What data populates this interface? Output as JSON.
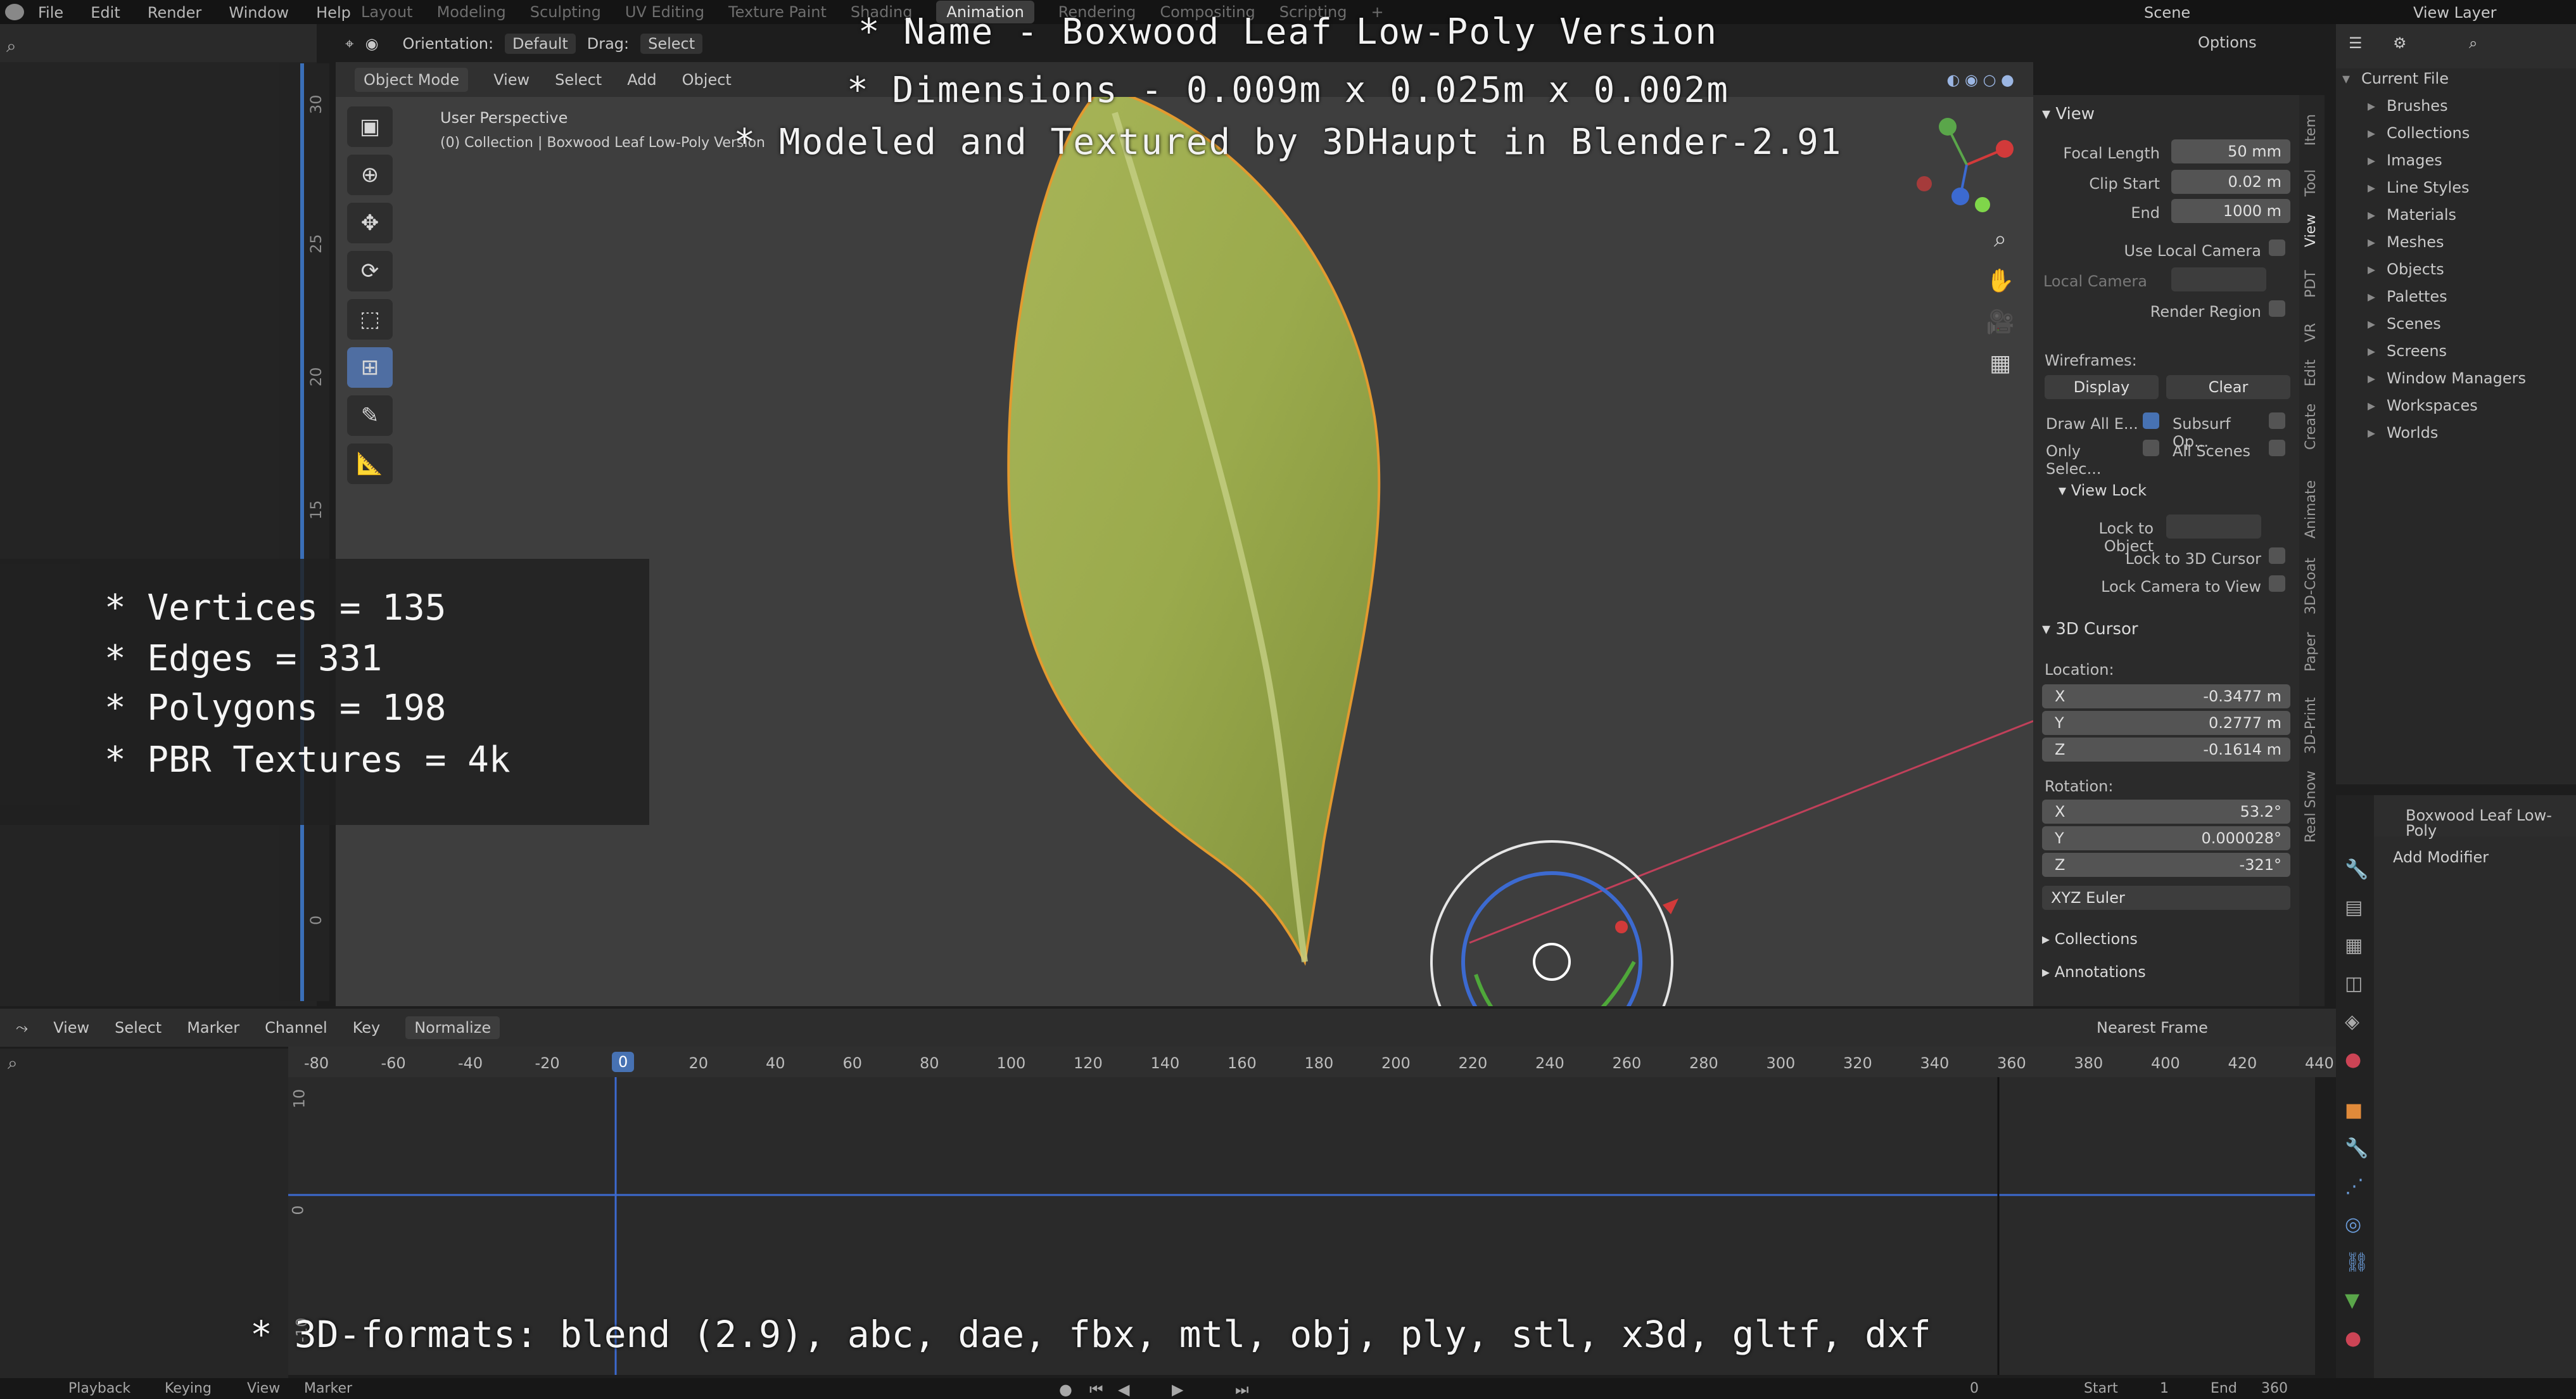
{
  "overlay": {
    "line1": "* Name - Boxwood Leaf Low-Poly Version",
    "line2": "* Dimensions -  0.009m x 0.025m x 0.002m",
    "line3": "* Modeled and Textured by 3DHaupt in Blender-2.91",
    "stats": [
      "* Vertices = 135",
      "* Edges = 331",
      "* Polygons = 198",
      "* PBR Textures = 4k"
    ],
    "formats": "* 3D-formats: blend (2.9), abc, dae, fbx, mtl, obj, ply, stl, x3d, gltf, dxf"
  },
  "topbar": {
    "menu": [
      "File",
      "Edit",
      "Render",
      "Window",
      "Help"
    ],
    "workspaces": [
      "Layout",
      "Modeling",
      "Sculpting",
      "UV Editing",
      "Texture Paint",
      "Shading",
      "Animation",
      "Rendering",
      "Compositing",
      "Scripting"
    ],
    "active_workspace": "Animation",
    "scene_label": "Scene",
    "view_layer_label": "View Layer"
  },
  "viewport": {
    "orientation_label": "Orientation:",
    "orientation_value": "Default",
    "drag_label": "Drag:",
    "drag_value": "Select",
    "options_label": "Options",
    "mode": "Object Mode",
    "menus": [
      "View",
      "Select",
      "Add",
      "Object"
    ],
    "perspective": "User Perspective",
    "collection_info": "(0) Collection | Boxwood Leaf Low-Poly Version"
  },
  "npanel": {
    "view_header": "View",
    "focal_length_label": "Focal Length",
    "focal_length": "50 mm",
    "clip_start_label": "Clip Start",
    "clip_start": "0.02 m",
    "end_label": "End",
    "end": "1000 m",
    "use_local_camera": "Use Local Camera",
    "local_camera": "Local Camera",
    "render_region": "Render Region",
    "wireframes": "Wireframes:",
    "display": "Display",
    "clear": "Clear",
    "draw_all": "Draw All E...",
    "subsurf": "Subsurf Op...",
    "only_selec": "Only Selec...",
    "all_scenes": "All Scenes",
    "view_lock": "View Lock",
    "lock_to_object": "Lock to Object",
    "lock_cursor": "Lock to 3D Cursor",
    "lock_camera": "Lock Camera to View",
    "cursor_header": "3D Cursor",
    "location_label": "Location:",
    "loc": [
      {
        "axis": "X",
        "value": "-0.3477 m"
      },
      {
        "axis": "Y",
        "value": "0.2777 m"
      },
      {
        "axis": "Z",
        "value": "-0.1614 m"
      }
    ],
    "rotation_label": "Rotation:",
    "rot": [
      {
        "axis": "X",
        "value": "53.2°"
      },
      {
        "axis": "Y",
        "value": "0.000028°"
      },
      {
        "axis": "Z",
        "value": "-321°"
      }
    ],
    "rotation_mode": "XYZ Euler",
    "collections": "Collections",
    "annotations": "Annotations",
    "tabs": [
      "Item",
      "Tool",
      "View",
      "PDT",
      "VR",
      "Edit",
      "Create",
      "Animate",
      "3D-Coat",
      "Paper",
      "3D-Print",
      "Real Snow"
    ]
  },
  "outliner": {
    "root": "Current File",
    "items": [
      "Brushes",
      "Collections",
      "Images",
      "Line Styles",
      "Materials",
      "Meshes",
      "Objects",
      "Palettes",
      "Scenes",
      "Screens",
      "Window Managers",
      "Workspaces",
      "Worlds"
    ]
  },
  "properties": {
    "object_name": "Boxwood Leaf Low-Poly",
    "add_modifier": "Add Modifier"
  },
  "timeline": {
    "menus": [
      "View",
      "Select",
      "Marker",
      "Channel",
      "Key"
    ],
    "normalize": "Normalize",
    "snap": "Nearest Frame",
    "ticks": [
      "-80",
      "-60",
      "-40",
      "-20",
      "0",
      "20",
      "40",
      "60",
      "80",
      "100",
      "120",
      "140",
      "160",
      "180",
      "200",
      "220",
      "240",
      "260",
      "280",
      "300",
      "320",
      "340",
      "360",
      "380",
      "400",
      "420",
      "440"
    ],
    "current_frame": "0",
    "y_labels": [
      "10",
      "0",
      "-10"
    ]
  },
  "playback": {
    "playback": "Playback",
    "keying": "Keying",
    "view": "View",
    "marker": "Marker",
    "frame": "0",
    "start_label": "Start",
    "start": "1",
    "end_label": "End",
    "end": "360"
  },
  "ruler_labels": [
    "30",
    "25",
    "20",
    "15",
    "0"
  ]
}
